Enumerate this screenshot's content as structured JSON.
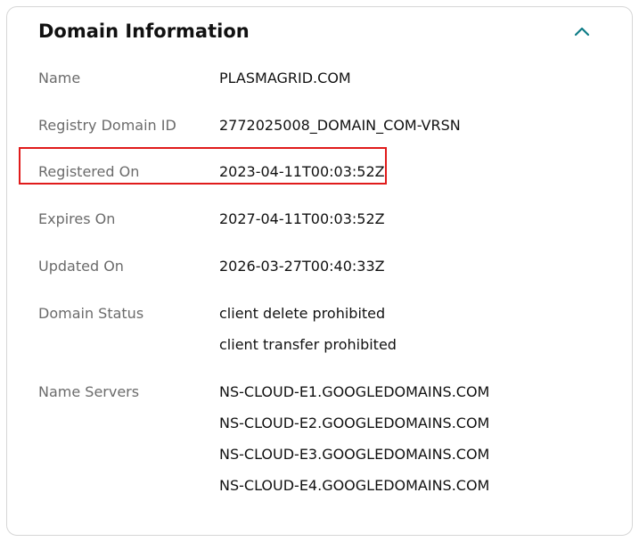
{
  "section": {
    "title": "Domain Information",
    "toggle_icon": "chevron-up-icon",
    "accent_color": "#0e7c86"
  },
  "fields": {
    "name": {
      "label": "Name",
      "value": "PLASMAGRID.COM"
    },
    "registry_domain_id": {
      "label": "Registry Domain ID",
      "value": "2772025008_DOMAIN_COM-VRSN"
    },
    "registered_on": {
      "label": "Registered On",
      "value": "2023-04-11T00:03:52Z"
    },
    "expires_on": {
      "label": "Expires On",
      "value": "2027-04-11T00:03:52Z"
    },
    "updated_on": {
      "label": "Updated On",
      "value": "2026-03-27T00:40:33Z"
    },
    "domain_status": {
      "label": "Domain Status",
      "values": [
        "client delete prohibited",
        "client transfer prohibited"
      ]
    },
    "name_servers": {
      "label": "Name Servers",
      "values": [
        "NS-CLOUD-E1.GOOGLEDOMAINS.COM",
        "NS-CLOUD-E2.GOOGLEDOMAINS.COM",
        "NS-CLOUD-E3.GOOGLEDOMAINS.COM",
        "NS-CLOUD-E4.GOOGLEDOMAINS.COM"
      ]
    }
  },
  "annotation": {
    "highlighted_field": "registered_on",
    "color": "#e01b1b"
  }
}
